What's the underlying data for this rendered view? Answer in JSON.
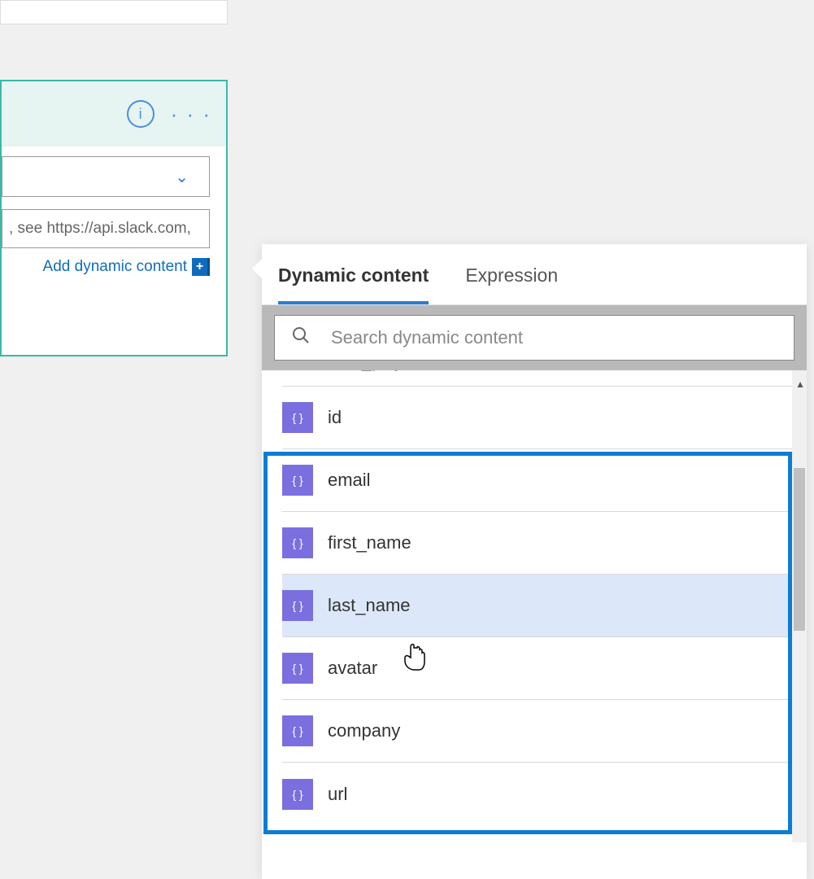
{
  "action_card": {
    "input_placeholder": ", see https://api.slack.com,",
    "add_dynamic_label": "Add dynamic content"
  },
  "flyout": {
    "tabs": {
      "dynamic_content": "Dynamic content",
      "expression": "Expression"
    },
    "search_placeholder": "Search dynamic content",
    "items": {
      "partial_top": "total_pages",
      "id": "id",
      "email": "email",
      "first_name": "first_name",
      "last_name": "last_name",
      "avatar": "avatar",
      "company": "company",
      "url": "url"
    }
  }
}
